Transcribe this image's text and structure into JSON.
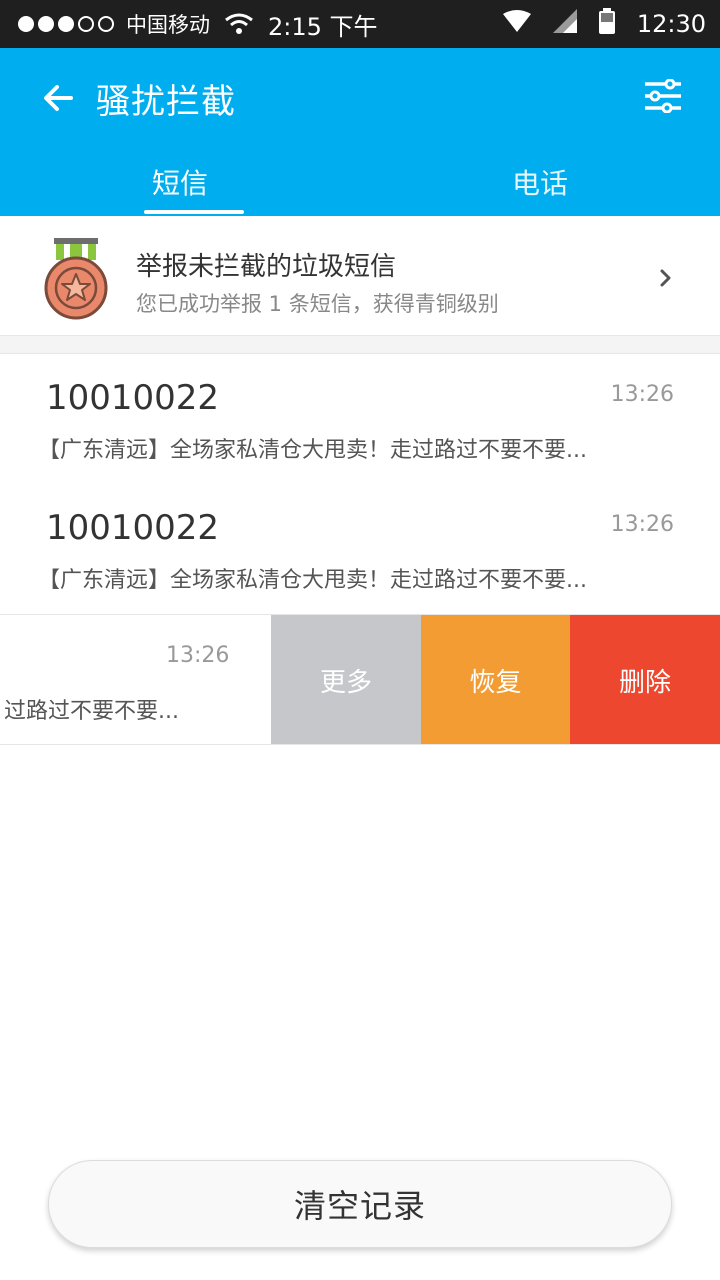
{
  "status_bar": {
    "carrier": "中国移动",
    "time_left": "2:15 下午",
    "time_right": "12:30"
  },
  "app_bar": {
    "title": "骚扰拦截",
    "tabs": [
      {
        "label": "短信",
        "active": true
      },
      {
        "label": "电话",
        "active": false
      }
    ]
  },
  "report": {
    "title": "举报未拦截的垃圾短信",
    "subtitle": "您已成功举报 1 条短信，获得青铜级别"
  },
  "messages": [
    {
      "number": "10010022",
      "time": "13:26",
      "preview": "【广东清远】全场家私清仓大甩卖！走过路过不要不要..."
    },
    {
      "number": "10010022",
      "time": "13:26",
      "preview": "【广东清远】全场家私清仓大甩卖！走过路过不要不要..."
    }
  ],
  "swiped_message": {
    "time": "13:26",
    "preview": "过路过不要不要...",
    "actions": {
      "more": "更多",
      "restore": "恢复",
      "delete": "删除"
    }
  },
  "footer": {
    "clear_label": "清空记录"
  },
  "colors": {
    "accent": "#00adef",
    "more": "#c6c7cb",
    "restore": "#f39c34",
    "delete": "#ee472f"
  }
}
